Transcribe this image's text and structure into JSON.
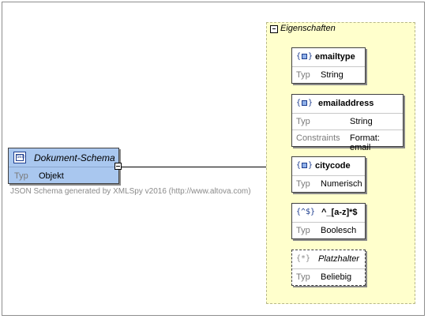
{
  "root": {
    "title": "Dokument-Schema",
    "type_label": "Typ",
    "type_value": "Objekt",
    "icon": "schema-document-icon",
    "badge": "SEQ"
  },
  "generated_text": "JSON Schema generated by XMLSpy v2016 (http://www.altova.com)",
  "properties": {
    "label": "Eigenschaften",
    "items": [
      {
        "name": "emailtype",
        "icon_text": "{",
        "icon_end": "}",
        "rows": [
          {
            "label": "Typ",
            "value": "String"
          }
        ]
      },
      {
        "name": "emailaddress",
        "icon_text": "{",
        "icon_end": "}",
        "rows": [
          {
            "label": "Typ",
            "value": "String"
          },
          {
            "label": "Constraints",
            "value": "Format: email"
          }
        ]
      },
      {
        "name": "citycode",
        "icon_text": "{",
        "icon_end": "}",
        "rows": [
          {
            "label": "Typ",
            "value": "Numerisch"
          }
        ]
      },
      {
        "name": "^_[a-z]*$",
        "icon_text": "{^$}",
        "rows": [
          {
            "label": "Typ",
            "value": "Boolesch"
          }
        ]
      },
      {
        "name": "Platzhalter",
        "icon_text": "{*}",
        "rows": [
          {
            "label": "Typ",
            "value": "Beliebig"
          }
        ]
      }
    ]
  }
}
